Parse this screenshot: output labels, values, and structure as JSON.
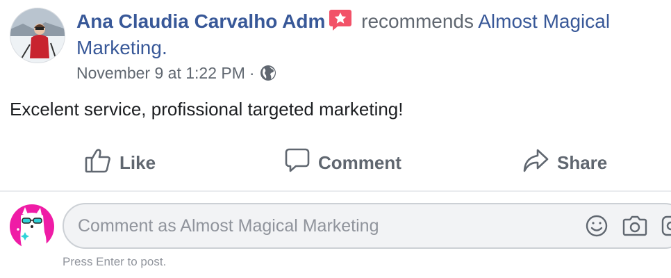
{
  "post": {
    "author": "Ana Claudia Carvalho Adm",
    "badge_icon": "recommendation-star-badge-icon",
    "verb": "recommends",
    "page_name": "Almost Magical Marketing.",
    "timestamp": "November 9 at 1:22 PM",
    "separator": "·",
    "privacy_icon": "globe-icon",
    "text": "Excelent service, profissional targeted marketing!"
  },
  "actions": {
    "like": "Like",
    "comment": "Comment",
    "share": "Share"
  },
  "comment_box": {
    "placeholder": "Comment as Almost Magical Marketing",
    "hint": "Press Enter to post.",
    "icons": [
      "emoji-icon",
      "camera-icon",
      "gif-icon"
    ]
  },
  "colors": {
    "link": "#385898",
    "secondary_text": "#606770",
    "badge": "#f25268",
    "brand_pink": "#ef1ca6"
  }
}
